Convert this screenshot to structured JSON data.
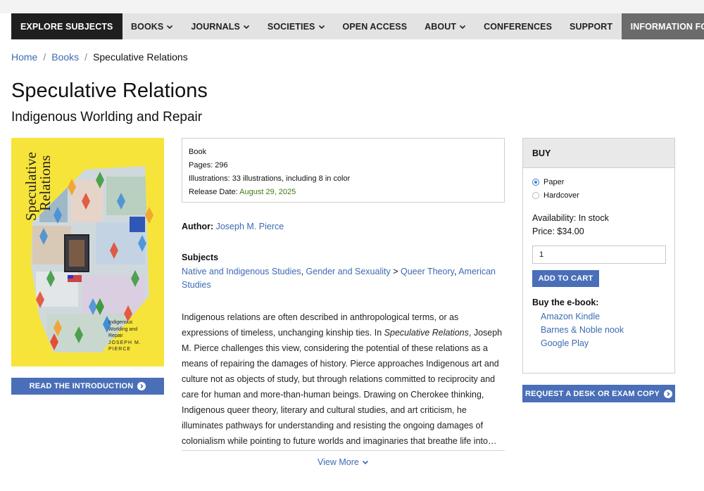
{
  "nav": {
    "items": [
      {
        "label": "EXPLORE SUBJECTS",
        "dropdown": false
      },
      {
        "label": "BOOKS",
        "dropdown": true
      },
      {
        "label": "JOURNALS",
        "dropdown": true
      },
      {
        "label": "SOCIETIES",
        "dropdown": true
      },
      {
        "label": "OPEN ACCESS",
        "dropdown": false
      },
      {
        "label": "ABOUT",
        "dropdown": true
      },
      {
        "label": "CONFERENCES",
        "dropdown": false
      },
      {
        "label": "SUPPORT",
        "dropdown": false
      }
    ],
    "info_label": "INFORMATION FOR"
  },
  "breadcrumb": {
    "home": "Home",
    "books": "Books",
    "current": "Speculative Relations"
  },
  "book": {
    "title": "Speculative Relations",
    "subtitle": "Indigenous Worlding and Repair",
    "cover": {
      "title_line1": "Speculative",
      "title_line2": "Relations",
      "subtitle_lines": [
        "Indigenous",
        "Worlding and",
        "Repair"
      ],
      "author_line1": "JOSEPH M.",
      "author_line2": "PIERCE"
    },
    "intro_button": "READ THE INTRODUCTION",
    "meta": {
      "type": "Book",
      "pages": "Pages: 296",
      "illustrations": "Illustrations: 33 illustrations, including 8 in color",
      "release_label": "Release Date: ",
      "release_date": "August 29, 2025"
    },
    "author_label": "Author:",
    "author_name": "Joseph M. Pierce",
    "subjects_heading": "Subjects",
    "subjects": {
      "s1": "Native and Indigenous Studies",
      "sep1": ", ",
      "s2": "Gender and Sexuality",
      "sep2": " > ",
      "s3": "Queer Theory",
      "sep3": ", ",
      "s4a": "American",
      "s4b": "Studies"
    },
    "description": {
      "l1": "Indigenous relations are often described in anthropological terms, or as",
      "l2a": "expressions of timeless, unchanging kinship ties. In ",
      "l2i": "Speculative Relations",
      "l2b": ", Joseph",
      "l3": "M. Pierce challenges this view, considering the potential of these relations as a",
      "l4": "means of repairing the damages of history. Pierce approaches Indigenous art and",
      "l5": "culture not as objects of study, but through relations committed to reciprocity and",
      "l6": "care for human and more-than-human beings. Drawing on Cherokee thinking,",
      "l7": "Indigenous queer theory, literary and cultural studies, and art criticism, he",
      "l8": "illuminates pathways for understanding and resisting the ongoing damages of",
      "l9": "colonialism while pointing to future worlds and imaginaries that breathe life into…"
    },
    "view_more": "View More"
  },
  "buy": {
    "heading": "BUY",
    "options": [
      {
        "label": "Paper",
        "selected": true
      },
      {
        "label": "Hardcover",
        "selected": false
      }
    ],
    "availability": "Availability: In stock",
    "price": "Price: $34.00",
    "quantity": "1",
    "add_to_cart": "ADD TO CART",
    "ebook_heading": "Buy the e-book:",
    "ebook_links": [
      "Amazon Kindle",
      "Barnes & Noble nook",
      "Google Play"
    ]
  },
  "desk_copy_button": "REQUEST A DESK OR EXAM COPY",
  "colors": {
    "link": "#3c6bb2",
    "button": "#4a6fb8",
    "date_green": "#3d7a12",
    "cover_yellow": "#f7e43a"
  }
}
